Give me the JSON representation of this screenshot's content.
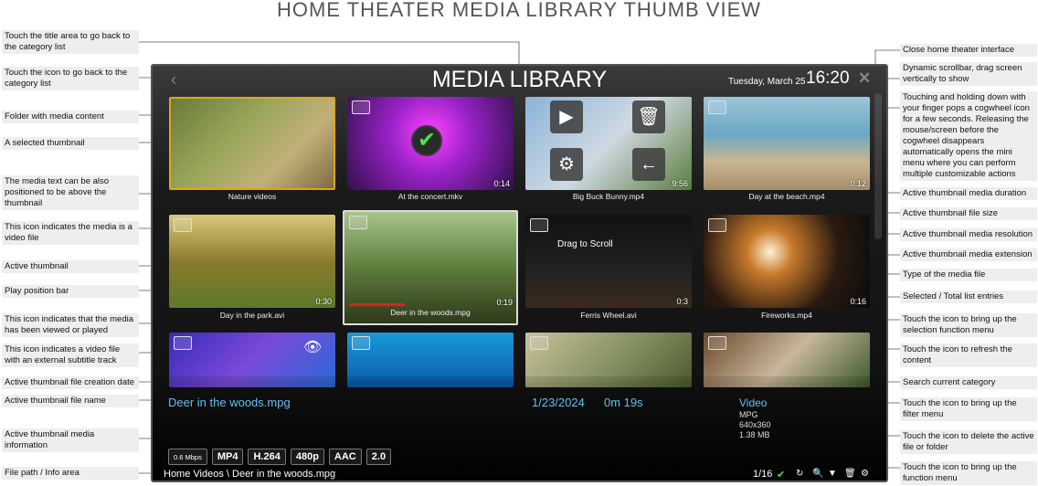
{
  "page_heading": "HOME THEATER MEDIA LIBRARY THUMB VIEW",
  "annotations_left": [
    "Touch the title area to go back to the category list",
    "Touch the icon to go back to the category list",
    "Folder with media content",
    "A selected thumbnail",
    "The media text can be also positioned to be above the thumbnail",
    "This icon indicates the media is a video file",
    "Active thumbnail",
    "Play position bar",
    "This icon indicates that the media has been viewed or played",
    "This icon indicates a video file with an external subtitle track",
    "Active thumbnail file creation date",
    "Active thumbnail file name",
    "Active thumbnail media information",
    "File path / Info area"
  ],
  "annotations_right": [
    "Close home theater interface",
    "Dynamic scrollbar, drag screen vertically to show",
    "Touching and holding down with your finger pops a cogwheel icon for a few seconds. Releasing the mouse/screen before the cogwheel disappears automatically opens the mini menu where you can perform multiple customizable actions",
    "Active thumbnail media duration",
    "Active thumbnail file size",
    "Active thumbnail media resolution",
    "Active thumbnail media extension",
    "Type of the media file",
    "Selected / Total list entries",
    "Touch the icon to bring up the selection function menu",
    "Touch the icon to refresh the content",
    "Search current category",
    "Touch the icon to bring up the filter menu",
    "Touch the icon to delete the active file or folder",
    "Touch the icon to bring up the function menu"
  ],
  "screen": {
    "title": "MEDIA LIBRARY",
    "date": "Tuesday, March 25",
    "time": "16:20",
    "drag_label": "Drag to Scroll",
    "thumbs": [
      {
        "caption": "Nature videos",
        "duration": ""
      },
      {
        "caption": "At the concert.mkv",
        "duration": "0:14"
      },
      {
        "caption": "Big Buck Bunny.mp4",
        "duration": "9:56"
      },
      {
        "caption": "Day at the beach.mp4",
        "duration": "0:12"
      },
      {
        "caption": "Day in the park.avi",
        "duration": "0:30"
      },
      {
        "caption": "Deer in the woods.mpg",
        "duration": "0:19"
      },
      {
        "caption": "Ferris Wheel.avi",
        "duration": "0:3"
      },
      {
        "caption": "Fireworks.mp4",
        "duration": "0:16"
      }
    ],
    "active": {
      "file_name": "Deer in the woods.mpg",
      "date": "1/23/2024",
      "duration": "0m 19s",
      "type": "Video",
      "extension": "MPG",
      "resolution": "640x360",
      "size": "1.38 MB"
    },
    "badges": [
      "0.6 Mbps",
      "MP4",
      "H.264",
      "480p",
      "AAC",
      "2.0"
    ],
    "path": "Home Videos \\ Deer in the woods.mpg",
    "count": "1/16"
  }
}
